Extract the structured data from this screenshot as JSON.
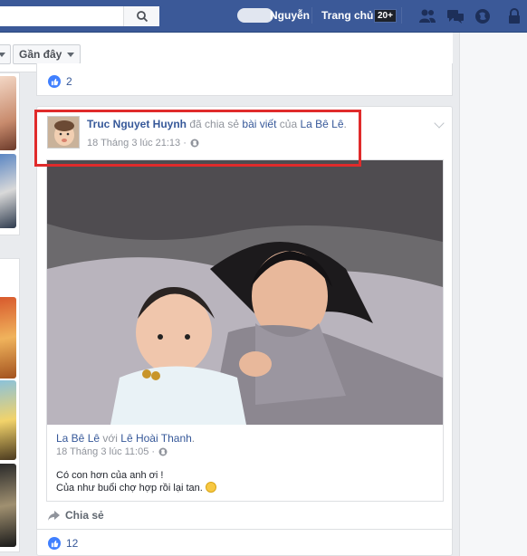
{
  "topbar": {
    "user_name": "Nguyễn",
    "home_label": "Trang chủ",
    "home_badge": "20+"
  },
  "filter": {
    "recent_label": "Gần đây"
  },
  "prev_post": {
    "like_count": "2"
  },
  "post": {
    "author": "Truc Nguyet Huynh",
    "action": "đã chia sẻ",
    "link_word": "bài viết",
    "of": "của",
    "source": "La Bê Lê",
    "period": ".",
    "timestamp": "18 Tháng 3 lúc 21:13 ·",
    "shared": {
      "author": "La Bê Lê",
      "with": "với",
      "tagged": "Lê Hoài Thanh",
      "period": ".",
      "timestamp": "18 Tháng 3 lúc 11:05 ·",
      "line1": "Có con hơn của anh ơi !",
      "line2": "Của như buổi chợ hợp rồi lại tan."
    },
    "share_label": "Chia sẻ",
    "like_count": "12"
  },
  "colors": {
    "topbar": "#3b5998",
    "link": "#365899",
    "highlight": "#e02b2b"
  }
}
